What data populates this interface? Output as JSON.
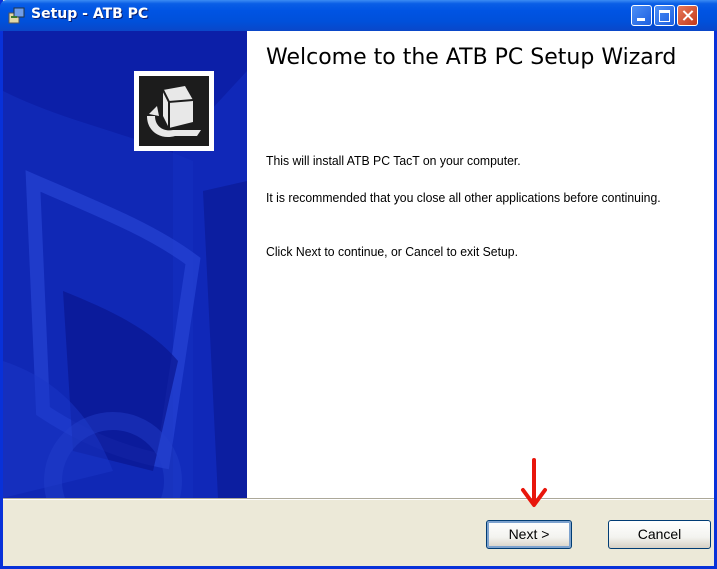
{
  "window": {
    "title": "Setup - ATB PC",
    "icon": "setup-installer-icon"
  },
  "title_buttons": [
    "minimize-icon",
    "maximize-icon",
    "close-icon"
  ],
  "content": {
    "heading": "Welcome to the ATB PC Setup Wizard",
    "paragraphs": [
      "This will install ATB PC TacT on your computer.",
      "It is recommended that you close all other applications before continuing.",
      "Click Next to continue, or Cancel to exit Setup."
    ]
  },
  "buttons": {
    "next": "Next >",
    "cancel": "Cancel"
  },
  "annotation": {
    "icon": "red-down-arrow-icon",
    "color": "#e8160c"
  },
  "colors": {
    "title_bar": "#0054e3",
    "banner": "#0c1fa8",
    "dialog_face": "#ece9d8"
  }
}
